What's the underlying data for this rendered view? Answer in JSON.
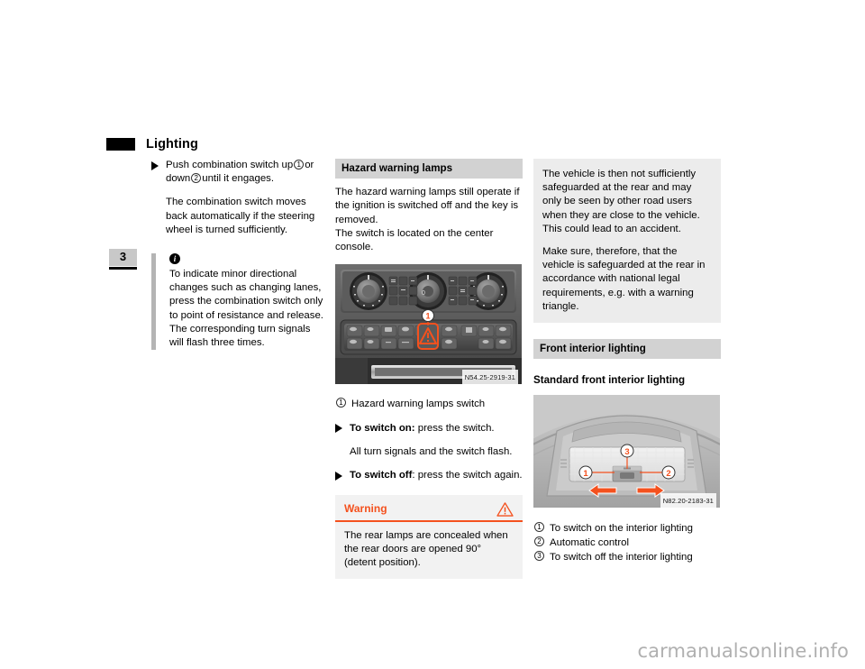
{
  "page": {
    "chapter_number": "3",
    "header_title": "Lighting",
    "watermark": "carmanualsonline.info"
  },
  "column1": {
    "bullet1": {
      "text_before": "Push combination switch up",
      "marker1": "1",
      "text_mid": "or down",
      "marker2": "2",
      "text_after": "until it engages."
    },
    "paragraph1": "The combination switch moves back automatically if the steering wheel is turned sufficiently.",
    "note": {
      "icon": "info-icon",
      "text": "To indicate minor directional changes such as changing lanes, press the combination switch only to point of resistance and release. The corresponding turn signals will flash three times."
    }
  },
  "column2": {
    "section_heading": "Hazard warning lamps",
    "paragraph1": "The hazard warning lamps still operate if the ignition is switched off and the key is removed.",
    "paragraph2": "The switch is located on the center console.",
    "figure": {
      "name": "center-console-photo",
      "caption": "N54.25-2919-31",
      "callout": "1"
    },
    "legend": [
      {
        "marker": "1",
        "label": "Hazard warning lamps switch"
      }
    ],
    "bullet_on": {
      "bold": "To switch on:",
      "rest": "press the switch."
    },
    "bullet_on_body": "All turn signals and the switch flash.",
    "bullet_off": {
      "bold": "To switch off",
      "rest": ": press the switch again."
    },
    "warning": {
      "title": "Warning",
      "icon": "warning-triangle-icon",
      "text": "The rear lamps are concealed when the rear doors are opened 90° (detent position)."
    }
  },
  "column3": {
    "info_box": {
      "paragraph1": "The vehicle is then not sufficiently safeguarded at the rear and may only be seen by other road users when they are close to the vehicle. This could lead to an accident.",
      "paragraph2": "Make sure, therefore, that the vehicle is safeguarded at the rear in accordance with national legal requirements, e.g. with a warning triangle."
    },
    "section_heading": "Front interior lighting",
    "sub_heading": "Standard front interior lighting",
    "figure": {
      "name": "overhead-console-photo",
      "caption": "N82.20-2183-31",
      "callouts": [
        "1",
        "2",
        "3"
      ]
    },
    "legend": [
      {
        "marker": "1",
        "label": "To switch on the interior lighting"
      },
      {
        "marker": "2",
        "label": "Automatic control"
      },
      {
        "marker": "3",
        "label": "To switch off the interior lighting"
      }
    ]
  },
  "colors": {
    "accent_warning": "#f4511e",
    "heading_bar": "#d2d2d2",
    "info_box": "#ececec",
    "note_bar": "#b4b4b4",
    "watermark": "#b0b0b0"
  }
}
